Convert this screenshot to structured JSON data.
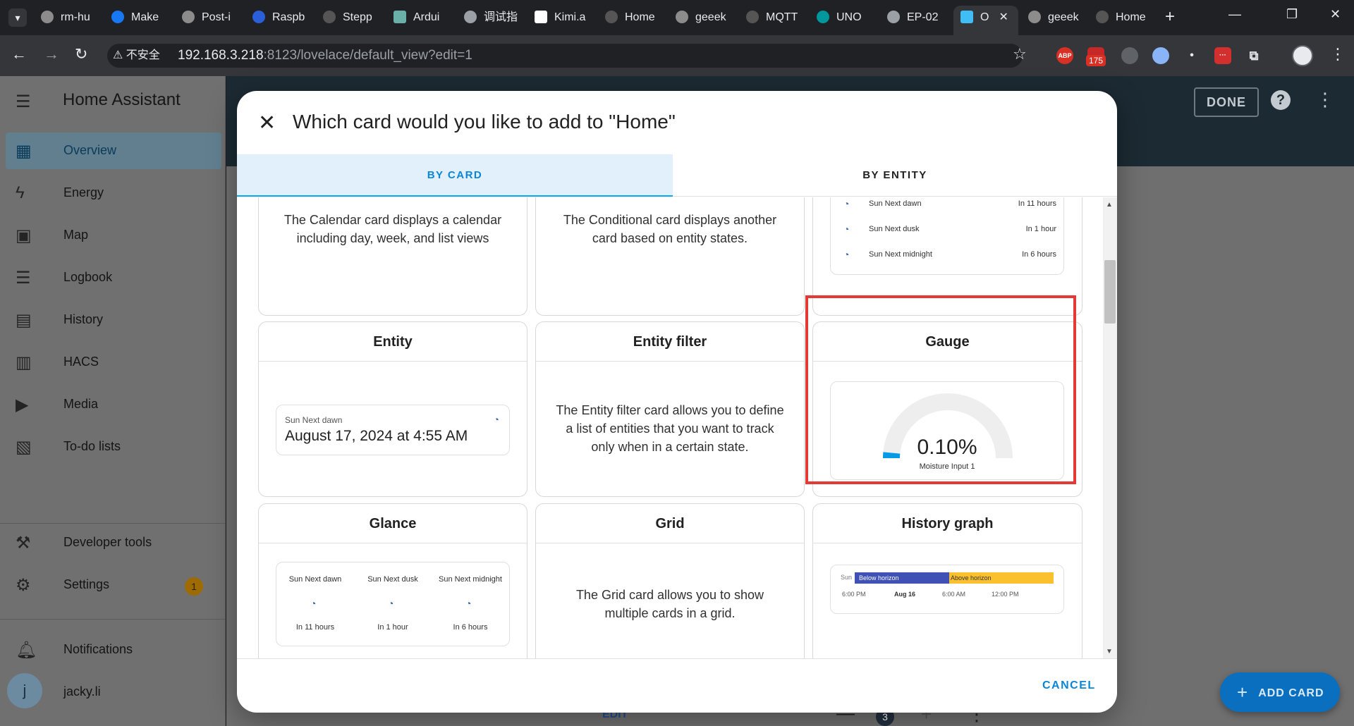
{
  "browser": {
    "tabs": [
      "rm-hu",
      "Make",
      "Post-i",
      "Raspb",
      "Stepp",
      "Ardui",
      "调试指",
      "Kimi.a",
      "Home",
      "geeek",
      "MQTT",
      "UNO",
      "EP-02",
      "O",
      "geeek",
      "Home"
    ],
    "active_tab_index": 13,
    "security_label": "不安全",
    "url_host": "192.168.3.218",
    "url_rest": ":8123/lovelace/default_view?edit=1",
    "ext_badge": "175",
    "ext_abp": "ABP"
  },
  "ha": {
    "title": "Home Assistant",
    "nav": [
      {
        "label": "Overview",
        "icon": "dashboard-icon",
        "selected": true
      },
      {
        "label": "Energy",
        "icon": "lightning-icon"
      },
      {
        "label": "Map",
        "icon": "map-icon"
      },
      {
        "label": "Logbook",
        "icon": "list-icon"
      },
      {
        "label": "History",
        "icon": "chart-icon"
      },
      {
        "label": "HACS",
        "icon": "hacs-icon"
      },
      {
        "label": "Media",
        "icon": "play-icon"
      },
      {
        "label": "To-do lists",
        "icon": "clipboard-icon"
      }
    ],
    "developer_tools": "Developer tools",
    "settings": "Settings",
    "settings_badge": "1",
    "notifications": "Notifications",
    "user_initial": "j",
    "user_name": "jacky.li",
    "done": "DONE",
    "add_card": "ADD CARD",
    "bg_edit": "EDIT",
    "bg_count": "3"
  },
  "dialog": {
    "title": "Which card would you like to add to \"Home\"",
    "tab_by_card": "BY CARD",
    "tab_by_entity": "BY ENTITY",
    "cancel": "CANCEL",
    "calendar_desc": "The Calendar card displays a calendar including day, week, and list views",
    "conditional_desc": "The Conditional card displays another card based on entity states.",
    "sun_rows": [
      {
        "name": "Sun Next dawn",
        "value": "In 11 hours"
      },
      {
        "name": "Sun Next dusk",
        "value": "In 1 hour"
      },
      {
        "name": "Sun Next midnight",
        "value": "In 6 hours"
      }
    ],
    "entity": {
      "title": "Entity",
      "label": "Sun Next dawn",
      "value": "August 17, 2024 at 4:55 AM"
    },
    "entity_filter": {
      "title": "Entity filter",
      "desc": "The Entity filter card allows you to define a list of entities that you want to track only when in a certain state."
    },
    "gauge": {
      "title": "Gauge",
      "value": "0.10%",
      "name": "Moisture Input 1",
      "level": 0.001
    },
    "glance": {
      "title": "Glance",
      "items": [
        {
          "name": "Sun Next dawn",
          "state": "In 11 hours"
        },
        {
          "name": "Sun Next dusk",
          "state": "In 1 hour"
        },
        {
          "name": "Sun Next midnight",
          "state": "In 6 hours"
        }
      ]
    },
    "grid": {
      "title": "Grid",
      "desc": "The Grid card allows you to show multiple cards in a grid."
    },
    "history": {
      "title": "History graph",
      "entity": "Sun",
      "below": "Below horizon",
      "above": "Above horizon",
      "below_color": "#3f51b5",
      "above_color": "#fbc02d",
      "ticks": [
        "6:00 PM",
        "Aug 16",
        "6:00 AM",
        "12:00 PM"
      ]
    }
  },
  "colors": {
    "accent": "#03a9f4",
    "highlight": "#e53935"
  }
}
